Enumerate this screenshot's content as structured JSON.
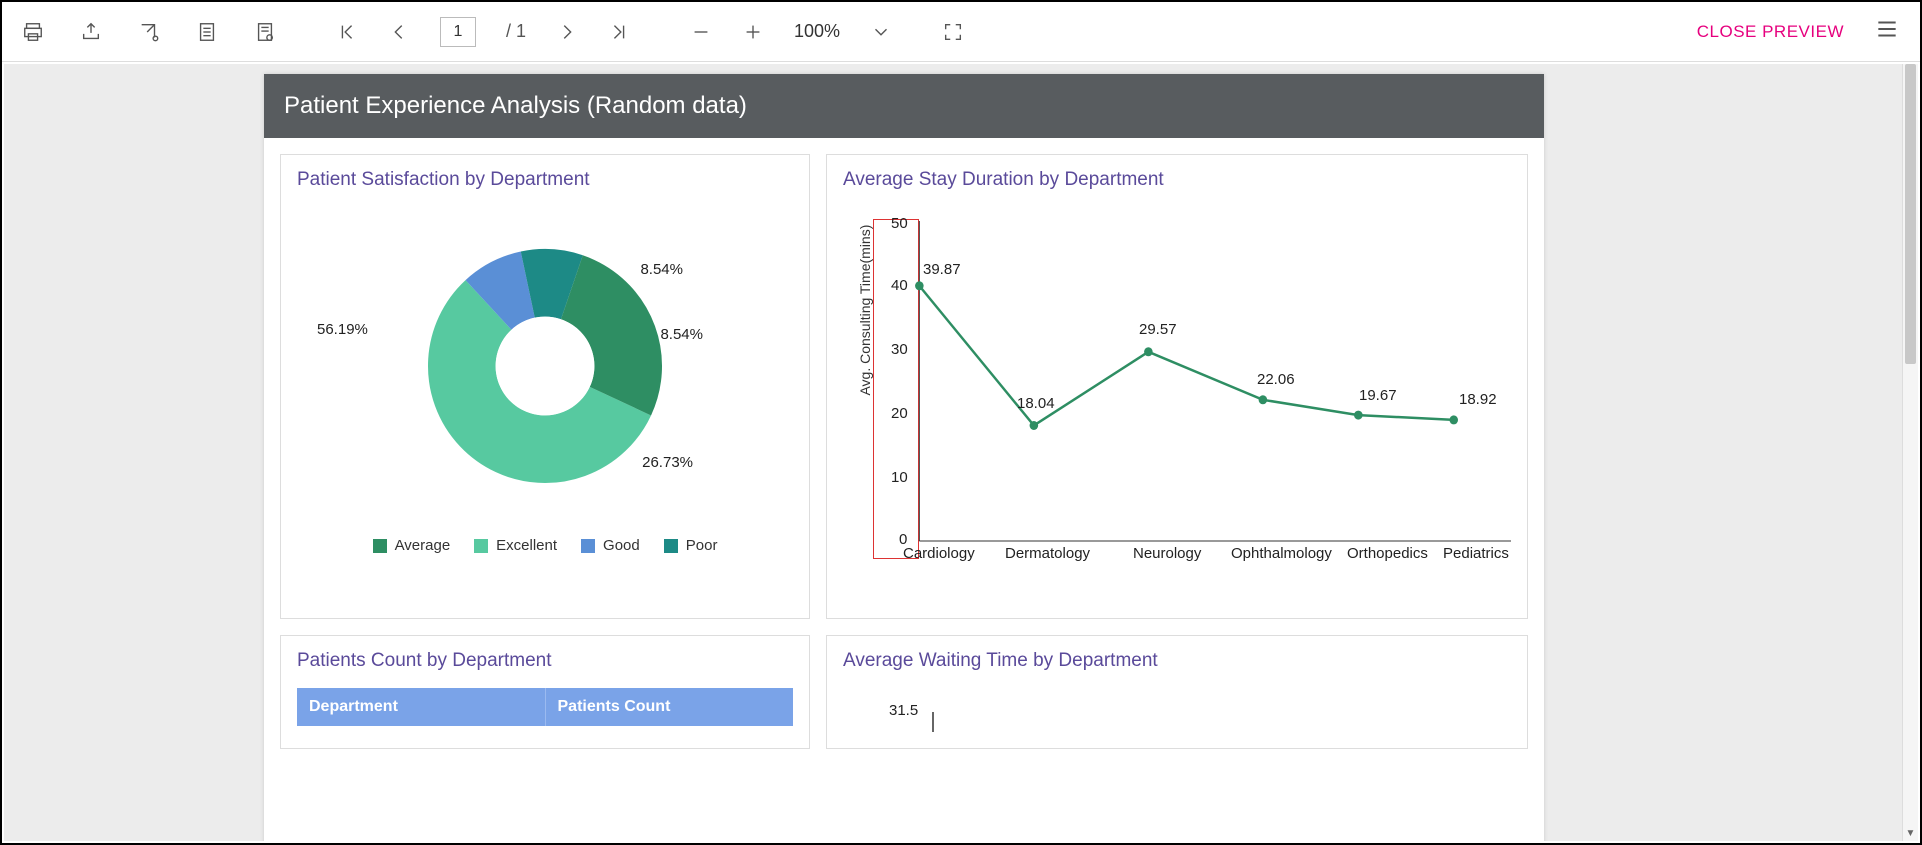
{
  "toolbar": {
    "page_current": "1",
    "page_total": "/ 1",
    "zoom": "100%",
    "close_label": "CLOSE PREVIEW"
  },
  "report": {
    "title": "Patient Experience Analysis (Random data)"
  },
  "cards": {
    "pie": {
      "title": "Patient Satisfaction by Department",
      "labels": {
        "excellent": "56.19%",
        "good": "8.54%",
        "poor": "8.54%",
        "average": "26.73%"
      },
      "legend": {
        "average": "Average",
        "excellent": "Excellent",
        "good": "Good",
        "poor": "Poor"
      }
    },
    "line": {
      "title": "Average Stay Duration by Department",
      "ylabel": "Avg. Consulting Time(mins)"
    },
    "table": {
      "title": "Patients Count by Department",
      "col1": "Department",
      "col2": "Patients Count"
    },
    "wait": {
      "title": "Average Waiting Time by Department",
      "tick": "31.5"
    }
  },
  "chart_data": [
    {
      "type": "pie",
      "title": "Patient Satisfaction by Department",
      "categories": [
        "Average",
        "Excellent",
        "Good",
        "Poor"
      ],
      "values": [
        26.73,
        56.19,
        8.54,
        8.54
      ],
      "colors": [
        "#2e8e63",
        "#57c9a0",
        "#5a8fd6",
        "#1d8a86"
      ]
    },
    {
      "type": "line",
      "title": "Average Stay Duration by Department",
      "xlabel": "",
      "ylabel": "Avg. Consulting Time(mins)",
      "ylim": [
        0,
        50
      ],
      "yticks": [
        0,
        10,
        20,
        30,
        40,
        50
      ],
      "categories": [
        "Cardiology",
        "Dermatology",
        "Neurology",
        "Ophthalmology",
        "Orthopedics",
        "Pediatrics"
      ],
      "values": [
        39.87,
        18.04,
        29.57,
        22.06,
        19.67,
        18.92
      ]
    },
    {
      "type": "line",
      "title": "Average Waiting Time by Department",
      "ylim": [
        0,
        31.5
      ],
      "yticks": [
        31.5
      ],
      "categories": [],
      "values": []
    }
  ],
  "line_points": {
    "cardiology": {
      "label": "Cardiology",
      "val": "39.87"
    },
    "dermatology": {
      "label": "Dermatology",
      "val": "18.04"
    },
    "neurology": {
      "label": "Neurology",
      "val": "29.57"
    },
    "ophthalmology": {
      "label": "Ophthalmology",
      "val": "22.06"
    },
    "orthopedics": {
      "label": "Orthopedics",
      "val": "19.67"
    },
    "pediatrics": {
      "label": "Pediatrics",
      "val": "18.92"
    }
  },
  "line_ticks": {
    "t0": "0",
    "t10": "10",
    "t20": "20",
    "t30": "30",
    "t40": "40",
    "t50": "50"
  }
}
